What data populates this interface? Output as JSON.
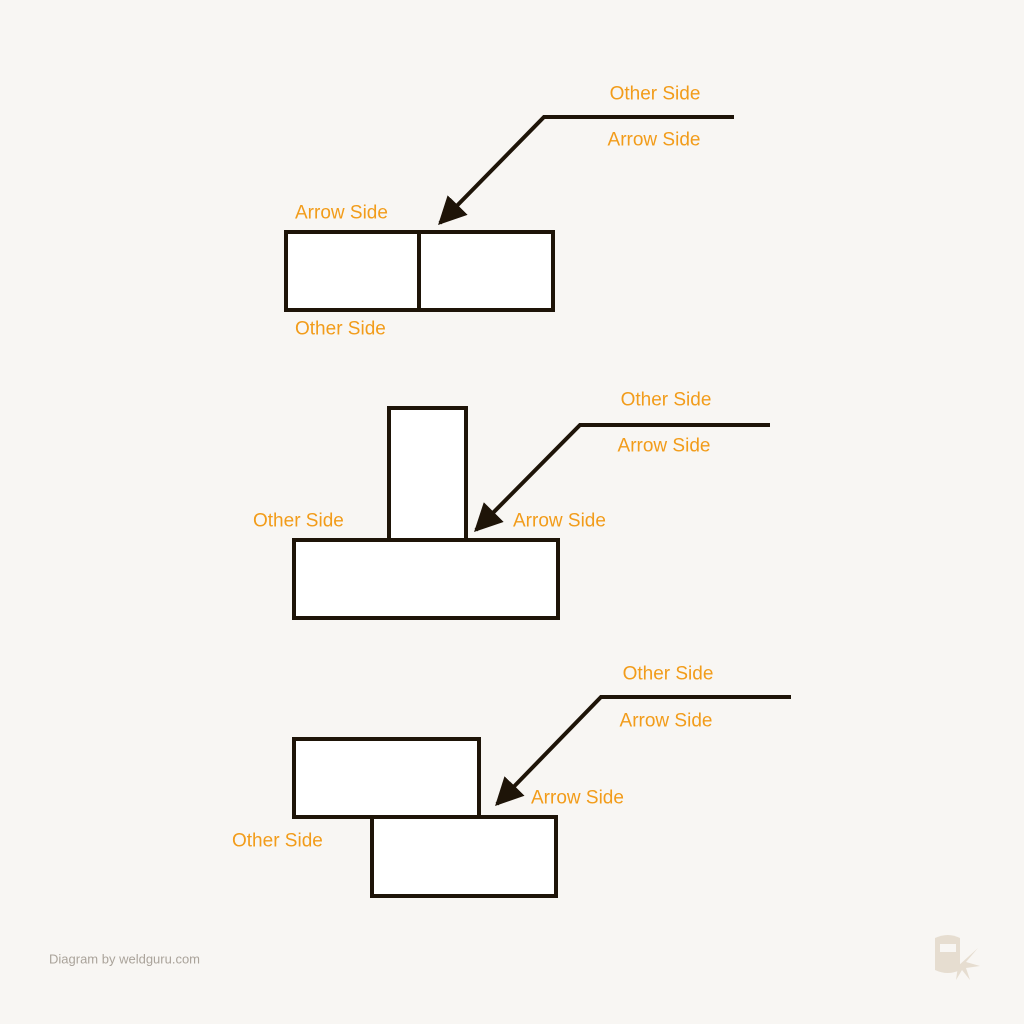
{
  "colors": {
    "label": "#f29c1a",
    "outline": "#1e1408",
    "background": "#f8f6f3",
    "fill": "#ffffff",
    "credit": "#aaa39a"
  },
  "diagrams": [
    {
      "name": "butt-joint",
      "leader_top": "Other Side",
      "leader_bottom": "Arrow Side",
      "part_arrow": "Arrow Side",
      "part_other": "Other Side"
    },
    {
      "name": "tee-joint",
      "leader_top": "Other Side",
      "leader_bottom": "Arrow Side",
      "part_arrow": "Arrow Side",
      "part_other": "Other Side"
    },
    {
      "name": "lap-joint",
      "leader_top": "Other Side",
      "leader_bottom": "Arrow Side",
      "part_arrow": "Arrow Side",
      "part_other": "Other Side"
    }
  ],
  "footer": {
    "credit": "Diagram by weldguru.com",
    "logo": "weldguru-helmet-logo"
  }
}
